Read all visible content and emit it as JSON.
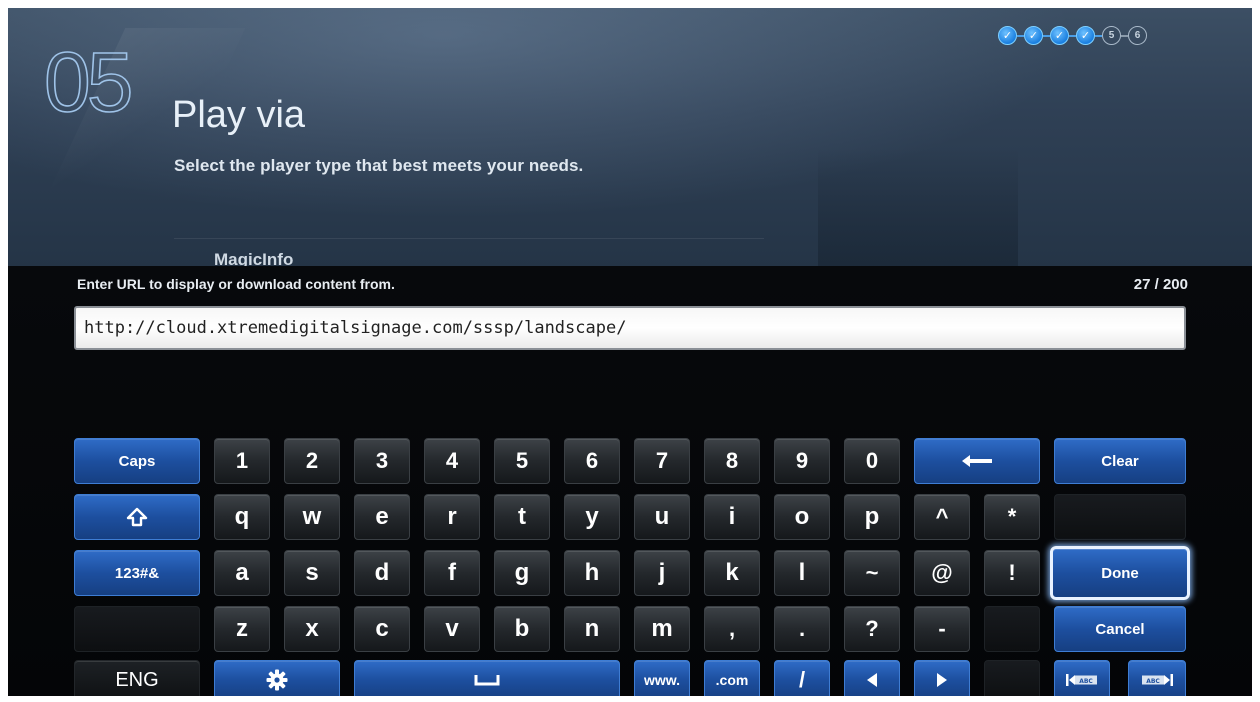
{
  "wizard": {
    "step_number": "05",
    "title": "Play via",
    "subtitle": "Select the player type that best meets your needs.",
    "obscured_item": "MagicInfo",
    "progress": [
      {
        "label": "",
        "state": "done"
      },
      {
        "label": "",
        "state": "done"
      },
      {
        "label": "",
        "state": "done"
      },
      {
        "label": "",
        "state": "done"
      },
      {
        "label": "5",
        "state": "current"
      },
      {
        "label": "6",
        "state": "todo"
      }
    ]
  },
  "input": {
    "prompt": "Enter URL to display or download content from.",
    "counter": "27 / 200",
    "value": "http://cloud.xtremedigitalsignage.com/sssp/landscape/"
  },
  "keyboard": {
    "caps": "Caps",
    "symbols": "123#&",
    "language": "ENG",
    "row1": [
      "1",
      "2",
      "3",
      "4",
      "5",
      "6",
      "7",
      "8",
      "9",
      "0"
    ],
    "row2": [
      "q",
      "w",
      "e",
      "r",
      "t",
      "y",
      "u",
      "i",
      "o",
      "p",
      "^",
      "*"
    ],
    "row3": [
      "a",
      "s",
      "d",
      "f",
      "g",
      "h",
      "j",
      "k",
      "l",
      "~",
      "@",
      "!"
    ],
    "row4": [
      "z",
      "x",
      "c",
      "v",
      "b",
      "n",
      "m",
      ",",
      ".",
      "?",
      "-"
    ],
    "clear": "Clear",
    "done": "Done",
    "cancel": "Cancel",
    "www": "www.",
    "com": ".com",
    "slash": "/",
    "colors": {
      "accent_blue": "#1d4f9f",
      "key_dark": "#24282c",
      "focus_outline": "#e9f2ff"
    }
  }
}
